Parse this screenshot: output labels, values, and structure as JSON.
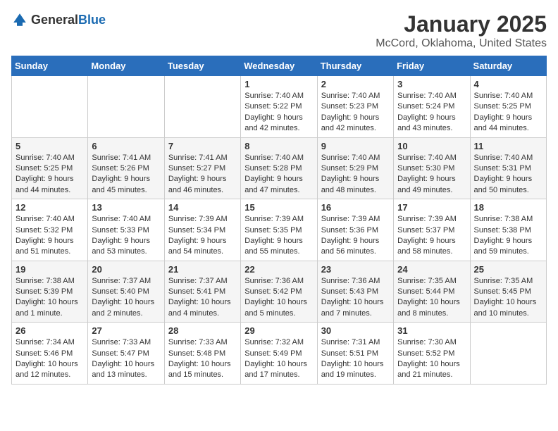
{
  "header": {
    "logo_general": "General",
    "logo_blue": "Blue",
    "month_title": "January 2025",
    "location": "McCord, Oklahoma, United States"
  },
  "weekdays": [
    "Sunday",
    "Monday",
    "Tuesday",
    "Wednesday",
    "Thursday",
    "Friday",
    "Saturday"
  ],
  "weeks": [
    [
      {
        "day": "",
        "info": ""
      },
      {
        "day": "",
        "info": ""
      },
      {
        "day": "",
        "info": ""
      },
      {
        "day": "1",
        "info": "Sunrise: 7:40 AM\nSunset: 5:22 PM\nDaylight: 9 hours and 42 minutes."
      },
      {
        "day": "2",
        "info": "Sunrise: 7:40 AM\nSunset: 5:23 PM\nDaylight: 9 hours and 42 minutes."
      },
      {
        "day": "3",
        "info": "Sunrise: 7:40 AM\nSunset: 5:24 PM\nDaylight: 9 hours and 43 minutes."
      },
      {
        "day": "4",
        "info": "Sunrise: 7:40 AM\nSunset: 5:25 PM\nDaylight: 9 hours and 44 minutes."
      }
    ],
    [
      {
        "day": "5",
        "info": "Sunrise: 7:40 AM\nSunset: 5:25 PM\nDaylight: 9 hours and 44 minutes."
      },
      {
        "day": "6",
        "info": "Sunrise: 7:41 AM\nSunset: 5:26 PM\nDaylight: 9 hours and 45 minutes."
      },
      {
        "day": "7",
        "info": "Sunrise: 7:41 AM\nSunset: 5:27 PM\nDaylight: 9 hours and 46 minutes."
      },
      {
        "day": "8",
        "info": "Sunrise: 7:40 AM\nSunset: 5:28 PM\nDaylight: 9 hours and 47 minutes."
      },
      {
        "day": "9",
        "info": "Sunrise: 7:40 AM\nSunset: 5:29 PM\nDaylight: 9 hours and 48 minutes."
      },
      {
        "day": "10",
        "info": "Sunrise: 7:40 AM\nSunset: 5:30 PM\nDaylight: 9 hours and 49 minutes."
      },
      {
        "day": "11",
        "info": "Sunrise: 7:40 AM\nSunset: 5:31 PM\nDaylight: 9 hours and 50 minutes."
      }
    ],
    [
      {
        "day": "12",
        "info": "Sunrise: 7:40 AM\nSunset: 5:32 PM\nDaylight: 9 hours and 51 minutes."
      },
      {
        "day": "13",
        "info": "Sunrise: 7:40 AM\nSunset: 5:33 PM\nDaylight: 9 hours and 53 minutes."
      },
      {
        "day": "14",
        "info": "Sunrise: 7:39 AM\nSunset: 5:34 PM\nDaylight: 9 hours and 54 minutes."
      },
      {
        "day": "15",
        "info": "Sunrise: 7:39 AM\nSunset: 5:35 PM\nDaylight: 9 hours and 55 minutes."
      },
      {
        "day": "16",
        "info": "Sunrise: 7:39 AM\nSunset: 5:36 PM\nDaylight: 9 hours and 56 minutes."
      },
      {
        "day": "17",
        "info": "Sunrise: 7:39 AM\nSunset: 5:37 PM\nDaylight: 9 hours and 58 minutes."
      },
      {
        "day": "18",
        "info": "Sunrise: 7:38 AM\nSunset: 5:38 PM\nDaylight: 9 hours and 59 minutes."
      }
    ],
    [
      {
        "day": "19",
        "info": "Sunrise: 7:38 AM\nSunset: 5:39 PM\nDaylight: 10 hours and 1 minute."
      },
      {
        "day": "20",
        "info": "Sunrise: 7:37 AM\nSunset: 5:40 PM\nDaylight: 10 hours and 2 minutes."
      },
      {
        "day": "21",
        "info": "Sunrise: 7:37 AM\nSunset: 5:41 PM\nDaylight: 10 hours and 4 minutes."
      },
      {
        "day": "22",
        "info": "Sunrise: 7:36 AM\nSunset: 5:42 PM\nDaylight: 10 hours and 5 minutes."
      },
      {
        "day": "23",
        "info": "Sunrise: 7:36 AM\nSunset: 5:43 PM\nDaylight: 10 hours and 7 minutes."
      },
      {
        "day": "24",
        "info": "Sunrise: 7:35 AM\nSunset: 5:44 PM\nDaylight: 10 hours and 8 minutes."
      },
      {
        "day": "25",
        "info": "Sunrise: 7:35 AM\nSunset: 5:45 PM\nDaylight: 10 hours and 10 minutes."
      }
    ],
    [
      {
        "day": "26",
        "info": "Sunrise: 7:34 AM\nSunset: 5:46 PM\nDaylight: 10 hours and 12 minutes."
      },
      {
        "day": "27",
        "info": "Sunrise: 7:33 AM\nSunset: 5:47 PM\nDaylight: 10 hours and 13 minutes."
      },
      {
        "day": "28",
        "info": "Sunrise: 7:33 AM\nSunset: 5:48 PM\nDaylight: 10 hours and 15 minutes."
      },
      {
        "day": "29",
        "info": "Sunrise: 7:32 AM\nSunset: 5:49 PM\nDaylight: 10 hours and 17 minutes."
      },
      {
        "day": "30",
        "info": "Sunrise: 7:31 AM\nSunset: 5:51 PM\nDaylight: 10 hours and 19 minutes."
      },
      {
        "day": "31",
        "info": "Sunrise: 7:30 AM\nSunset: 5:52 PM\nDaylight: 10 hours and 21 minutes."
      },
      {
        "day": "",
        "info": ""
      }
    ]
  ]
}
